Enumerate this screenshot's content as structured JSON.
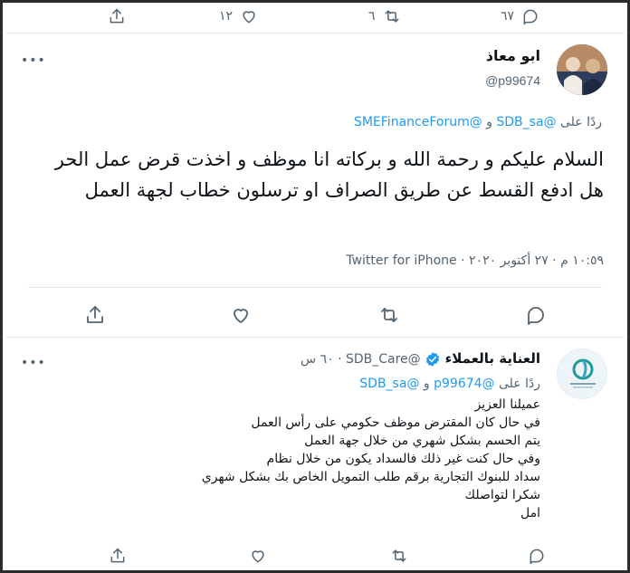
{
  "top_actions": {
    "reply_count": "٦٧",
    "retweet_count": "٦",
    "like_count": "١٢"
  },
  "tweet": {
    "author_name": "ابو معاذ",
    "author_handle": "@p99674",
    "reply_prefix": "ردًا على",
    "reply_to_1": "@SDB_sa",
    "reply_and": "و",
    "reply_to_2": "@SMEFinanceForum",
    "text": "السلام عليكم و رحمة الله و بركاته انا موظف و اخذت قرض عمل الحر هل ادفع القسط عن طريق الصراف او ترسلون خطاب لجهة العمل",
    "time": "١٠:٥٩ م",
    "date": "٢٧ أكتوبر ٢٠٢٠",
    "separator": "·",
    "source": "Twitter for iPhone"
  },
  "reply": {
    "author_name": "العناية بالعملاء",
    "author_handle": "@SDB_Care",
    "time_ago": "٦٠ س",
    "dot": "·",
    "reply_prefix": "ردًا على",
    "reply_to_1": "@p99674",
    "reply_and": "و",
    "reply_to_2": "@SDB_sa",
    "lines": [
      "عميلنا العزيز",
      "في حال كان المقترض موظف حكومي على رأس العمل",
      "يتم الحسم بشكل شهري من خلال جهة العمل",
      "وفي حال كنت غير ذلك فالسداد يكون من خلال نظام",
      "سداد للبنوك التجارية برقم طلب التمويل الخاص بك بشكل شهري",
      "شكرا لتواصلك",
      "امل"
    ]
  },
  "more_glyph": "•••",
  "colors": {
    "accent": "#1d9bf0",
    "muted": "#536471",
    "text": "#0f1419",
    "border": "#e1e8ed",
    "verified": "#1d9bf0"
  }
}
